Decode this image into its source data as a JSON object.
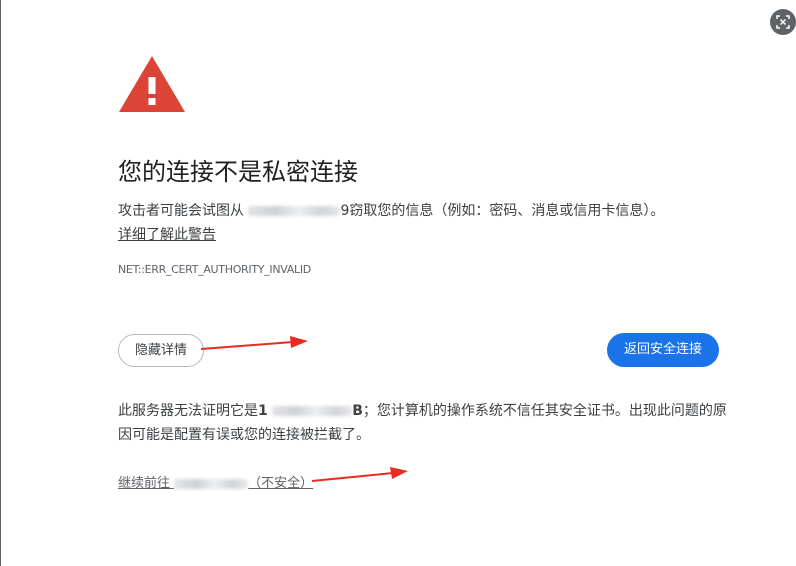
{
  "interstitial": {
    "heading": "您的连接不是私密连接",
    "paragraph_start": "攻击者可能会试图从",
    "paragraph_redacted_tail": "9",
    "paragraph_end": "窃取您的信息（例如：密码、消息或信用卡信息）。",
    "learn_more": "详细了解此警告",
    "error_code": "NET::ERR_CERT_AUTHORITY_INVALID",
    "hide_details_button": "隐藏详情",
    "back_to_safety_button": "返回安全连接",
    "details_start": "此服务器无法证明它是",
    "details_redacted_head": "1",
    "details_redacted_tail": "B",
    "details_end": "；您计算机的操作系统不信任其安全证书。出现此问题的原因可能是配置有误或您的连接被拦截了。",
    "proceed_prefix": "继续前往",
    "proceed_suffix": "（不安全）"
  },
  "colors": {
    "warning_red": "#db4437",
    "primary_blue": "#1a73e8",
    "annotation_arrow": "#ea2b22"
  },
  "icons": {
    "warning": "warning-triangle-icon",
    "corner": "screenshot-tool-icon"
  }
}
